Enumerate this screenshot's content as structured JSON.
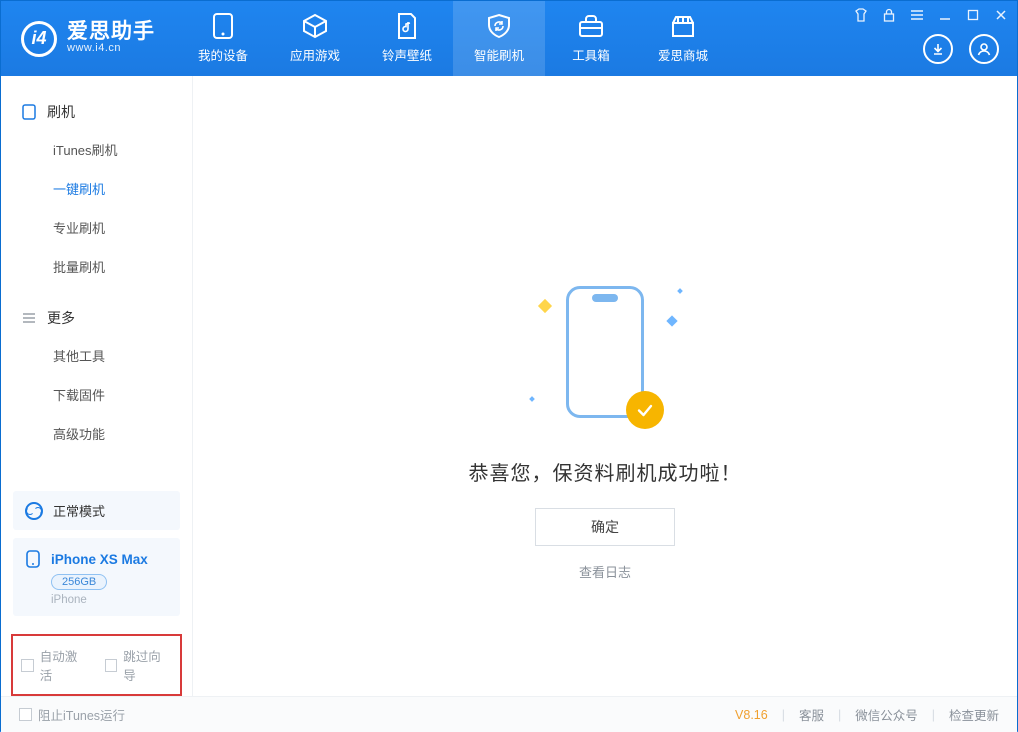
{
  "app": {
    "name_cn": "爱思助手",
    "name_en": "www.i4.cn"
  },
  "nav": [
    {
      "key": "device",
      "label": "我的设备"
    },
    {
      "key": "apps",
      "label": "应用游戏"
    },
    {
      "key": "rings",
      "label": "铃声壁纸"
    },
    {
      "key": "flash",
      "label": "智能刷机",
      "active": true
    },
    {
      "key": "toolbox",
      "label": "工具箱"
    },
    {
      "key": "store",
      "label": "爱思商城"
    }
  ],
  "sidebar": {
    "sections": [
      {
        "title": "刷机",
        "items": [
          {
            "key": "itunes",
            "label": "iTunes刷机"
          },
          {
            "key": "oneclick",
            "label": "一键刷机",
            "active": true
          },
          {
            "key": "pro",
            "label": "专业刷机"
          },
          {
            "key": "batch",
            "label": "批量刷机"
          }
        ]
      },
      {
        "title": "更多",
        "items": [
          {
            "key": "othertools",
            "label": "其他工具"
          },
          {
            "key": "firmware",
            "label": "下载固件"
          },
          {
            "key": "advanced",
            "label": "高级功能"
          }
        ]
      }
    ],
    "mode": {
      "label": "正常模式"
    },
    "device": {
      "name": "iPhone XS Max",
      "capacity": "256GB",
      "type": "iPhone"
    },
    "checks": {
      "auto_activate": "自动激活",
      "skip_guide": "跳过向导"
    }
  },
  "main": {
    "success_text": "恭喜您，保资料刷机成功啦！",
    "ok_label": "确定",
    "log_link": "查看日志"
  },
  "footer": {
    "stop_itunes": "阻止iTunes运行",
    "version": "V8.16",
    "links": {
      "service": "客服",
      "wechat": "微信公众号",
      "check_update": "检查更新"
    }
  }
}
